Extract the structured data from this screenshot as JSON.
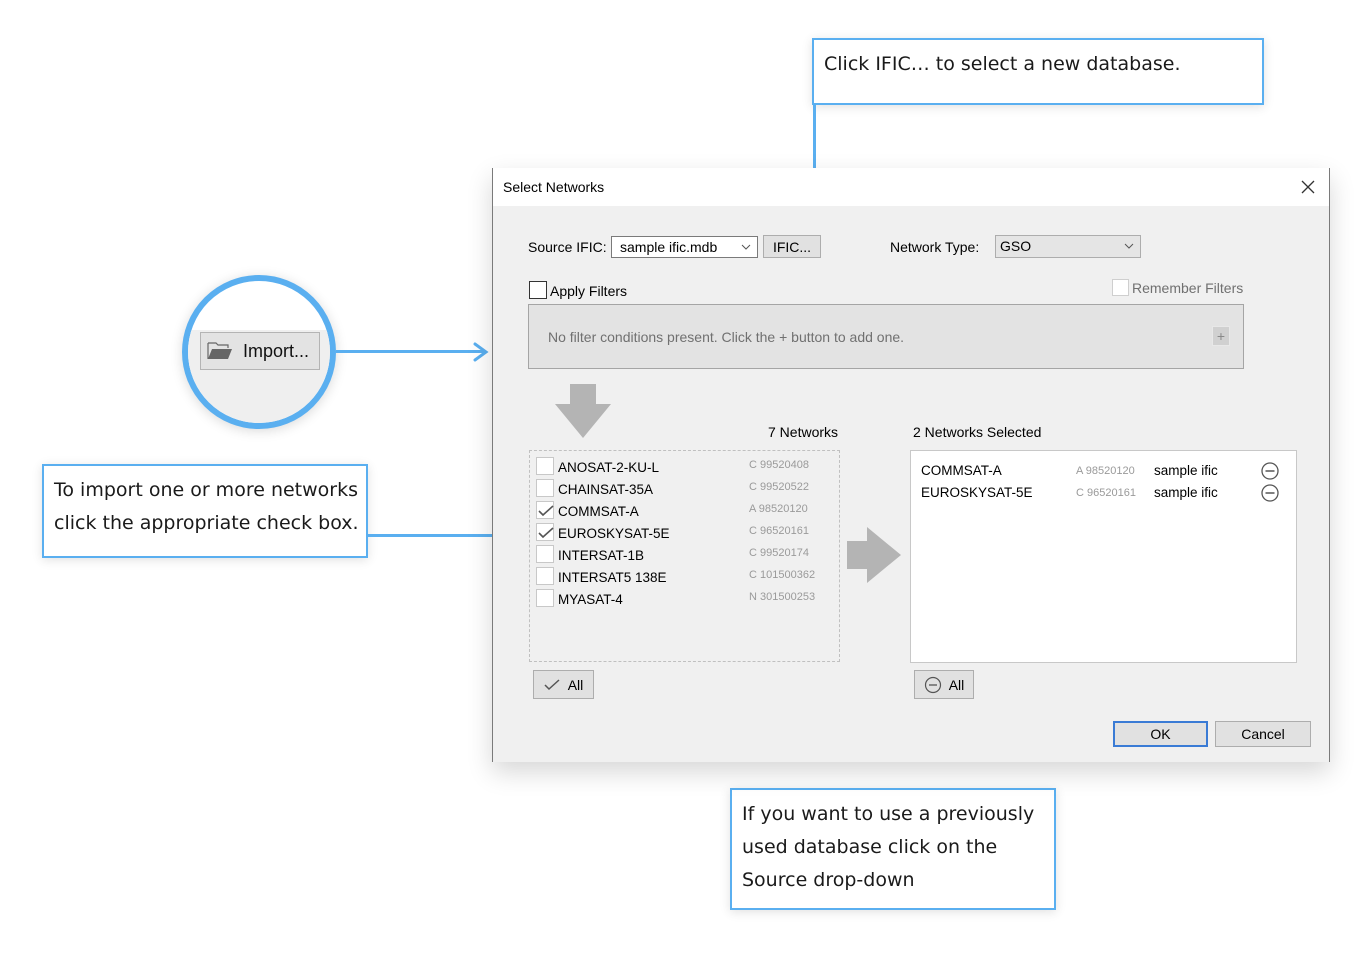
{
  "callouts": {
    "ific": {
      "lines": [
        "Click IFIC… to select a new database."
      ]
    },
    "checkbox": {
      "lines": [
        "To import one or more networks",
        "click the appropriate check box."
      ]
    },
    "source": {
      "lines": [
        "If you want to use a previously",
        "used database click on the",
        "Source drop-down"
      ]
    }
  },
  "magnifier": {
    "import_label": "Import...",
    "icon": "folder-open-icon"
  },
  "colors": {
    "accent": "#5aaff0",
    "dialog_bg": "#f0f0f0",
    "focus_border": "#3a7bd5",
    "muted_text": "#9a9a9a"
  },
  "dialog": {
    "title": "Select Networks",
    "source_label": "Source IFIC:",
    "source_value": "sample ific.mdb",
    "ific_button": "IFIC...",
    "network_type_label": "Network Type:",
    "network_type_value": "GSO",
    "apply_filters_label": "Apply Filters",
    "apply_filters_checked": false,
    "remember_filters_label": "Remember Filters",
    "remember_filters_checked": false,
    "filter_message": "No filter conditions present. Click the + button to add one.",
    "add_filter_symbol": "+",
    "available_count_label": "7 Networks",
    "available": [
      {
        "name": "ANOSAT-2-KU-L",
        "code": "C  99520408",
        "checked": false
      },
      {
        "name": "CHAINSAT-35A",
        "code": "C  99520522",
        "checked": false
      },
      {
        "name": "COMMSAT-A",
        "code": "A  98520120",
        "checked": true
      },
      {
        "name": "EUROSKYSAT-5E",
        "code": "C  96520161",
        "checked": true
      },
      {
        "name": "INTERSAT-1B",
        "code": "C  99520174",
        "checked": false
      },
      {
        "name": "INTERSAT5 138E",
        "code": "C  101500362",
        "checked": false
      },
      {
        "name": "MYASAT-4",
        "code": "N  301500253",
        "checked": false
      }
    ],
    "select_all_label": "All",
    "selected_count_label": "2 Networks Selected",
    "selected": [
      {
        "name": "COMMSAT-A",
        "code": "A  98520120",
        "source": "sample ific"
      },
      {
        "name": "EUROSKYSAT-5E",
        "code": "C  96520161",
        "source": "sample ific"
      }
    ],
    "remove_all_label": "All",
    "ok_label": "OK",
    "cancel_label": "Cancel"
  }
}
